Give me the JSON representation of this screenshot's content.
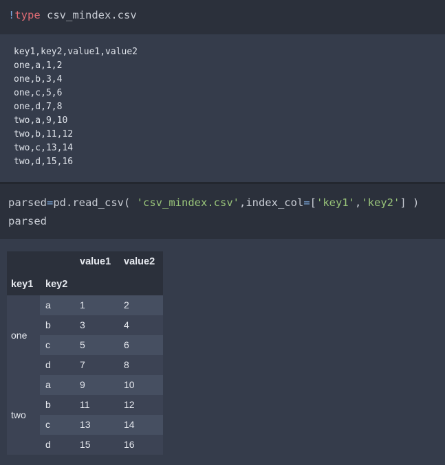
{
  "cell1": {
    "bang": "!",
    "command": "type",
    "argument": " csv_mindex.csv"
  },
  "csv_output": [
    "key1,key2,value1,value2",
    "one,a,1,2",
    "one,b,3,4",
    "one,c,5,6",
    "one,d,7,8",
    "two,a,9,10",
    "two,b,11,12",
    "two,c,13,14",
    "two,d,15,16"
  ],
  "cell2": {
    "line1": {
      "var": "parsed",
      "eq": "=",
      "call": "pd.read_csv( ",
      "path": "'csv_mindex.csv'",
      "kwarg": ",index_col",
      "eq2": "=",
      "open": "[",
      "k1": "'key1'",
      "comma": ",",
      "k2": "'key2'",
      "close": "] )"
    },
    "line2": "parsed"
  },
  "dataframe": {
    "columns": [
      "value1",
      "value2"
    ],
    "index_names": [
      "key1",
      "key2"
    ],
    "groups": [
      {
        "key1": "one",
        "rows": [
          {
            "key2": "a",
            "value1": "1",
            "value2": "2"
          },
          {
            "key2": "b",
            "value1": "3",
            "value2": "4"
          },
          {
            "key2": "c",
            "value1": "5",
            "value2": "6"
          },
          {
            "key2": "d",
            "value1": "7",
            "value2": "8"
          }
        ]
      },
      {
        "key1": "two",
        "rows": [
          {
            "key2": "a",
            "value1": "9",
            "value2": "10"
          },
          {
            "key2": "b",
            "value1": "11",
            "value2": "12"
          },
          {
            "key2": "c",
            "value1": "13",
            "value2": "14"
          },
          {
            "key2": "d",
            "value1": "15",
            "value2": "16"
          }
        ]
      }
    ]
  }
}
